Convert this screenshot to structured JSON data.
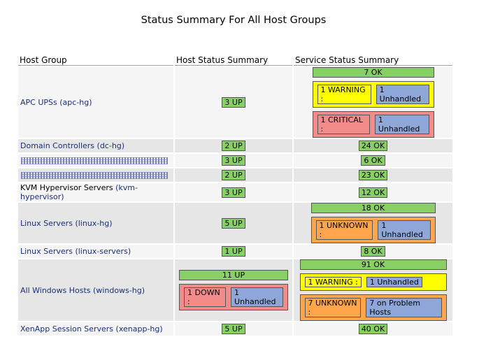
{
  "title": "Status Summary For All Host Groups",
  "columns": {
    "host_group": "Host Group",
    "host_status": "Host Status Summary",
    "service_status": "Service Status Summary"
  },
  "rows": [
    {
      "name": "APC UPSs",
      "alias": "(apc-hg)",
      "host_up": "3 UP",
      "svc_ok": "7 OK",
      "svc_warning": "1 WARNING :",
      "svc_warning_unhandled": "1 Unhandled",
      "svc_critical": "1 CRITICAL :",
      "svc_critical_unhandled": "1 Unhandled"
    },
    {
      "name": "Domain Controllers",
      "alias": "(dc-hg)",
      "host_up": "2 UP",
      "svc_ok": "24 OK"
    },
    {
      "name": "",
      "alias": "",
      "host_up": "3 UP",
      "svc_ok": "6 OK"
    },
    {
      "name": "",
      "alias": "",
      "host_up": "2 UP",
      "svc_ok": "23 OK"
    },
    {
      "name": "KVM Hypervisor Servers",
      "alias": "(kvm-hypervisor)",
      "host_up": "3 UP",
      "svc_ok": "12 OK"
    },
    {
      "name": "Linux Servers",
      "alias": "(linux-hg)",
      "host_up": "5 UP",
      "svc_ok": "18 OK",
      "svc_unknown": "1 UNKNOWN :",
      "svc_unknown_unhandled": "1 Unhandled"
    },
    {
      "name": "Linux Servers",
      "alias": "(linux-servers)",
      "host_up": "1 UP",
      "svc_ok": "8 OK"
    },
    {
      "name": "All Windows Hosts",
      "alias": "(windows-hg)",
      "host_up": "11 UP",
      "host_down": "1 DOWN :",
      "host_down_unhandled": "1 Unhandled",
      "svc_ok": "91 OK",
      "svc_warning": "1 WARNING :",
      "svc_warning_unhandled": "1 Unhandled",
      "svc_unknown": "7 UNKNOWN :",
      "svc_unknown_problem": "7 on Problem Hosts"
    },
    {
      "name": "XenApp Session Servers",
      "alias": "(xenapp-hg)",
      "host_up": "5 UP",
      "svc_ok": "40 OK"
    }
  ],
  "colors": {
    "ok": "#88d066",
    "warning": "#ffff00",
    "critical": "#f48b8b",
    "unknown": "#ffa64d",
    "unhandled": "#8fa7d8",
    "link": "#1b2f78"
  }
}
